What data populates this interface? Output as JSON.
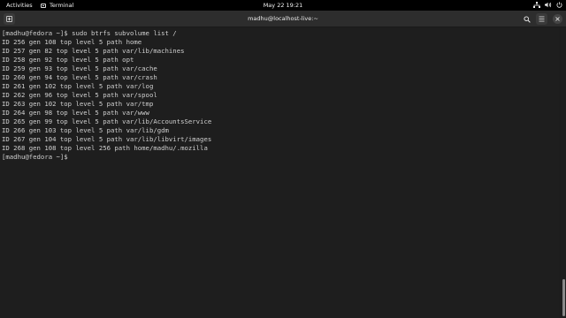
{
  "topbar": {
    "activities": "Activities",
    "app_name": "Terminal",
    "clock": "May 22  19:21",
    "icons": [
      "network-icon",
      "volume-icon",
      "power-icon"
    ]
  },
  "window": {
    "title": "madhu@localhost-live:~",
    "buttons": [
      "new-tab-icon",
      "search-icon",
      "hamburger-menu-icon",
      "close-icon"
    ]
  },
  "terminal": {
    "lines": [
      "[madhu@fedora ~]$ sudo btrfs subvolume list /",
      "ID 256 gen 108 top level 5 path home",
      "ID 257 gen 82 top level 5 path var/lib/machines",
      "ID 258 gen 92 top level 5 path opt",
      "ID 259 gen 93 top level 5 path var/cache",
      "ID 260 gen 94 top level 5 path var/crash",
      "ID 261 gen 102 top level 5 path var/log",
      "ID 262 gen 96 top level 5 path var/spool",
      "ID 263 gen 102 top level 5 path var/tmp",
      "ID 264 gen 98 top level 5 path var/www",
      "ID 265 gen 99 top level 5 path var/lib/AccountsService",
      "ID 266 gen 103 top level 5 path var/lib/gdm",
      "ID 267 gen 104 top level 5 path var/lib/libvirt/images",
      "ID 268 gen 108 top level 256 path home/madhu/.mozilla",
      "[madhu@fedora ~]$ "
    ]
  }
}
